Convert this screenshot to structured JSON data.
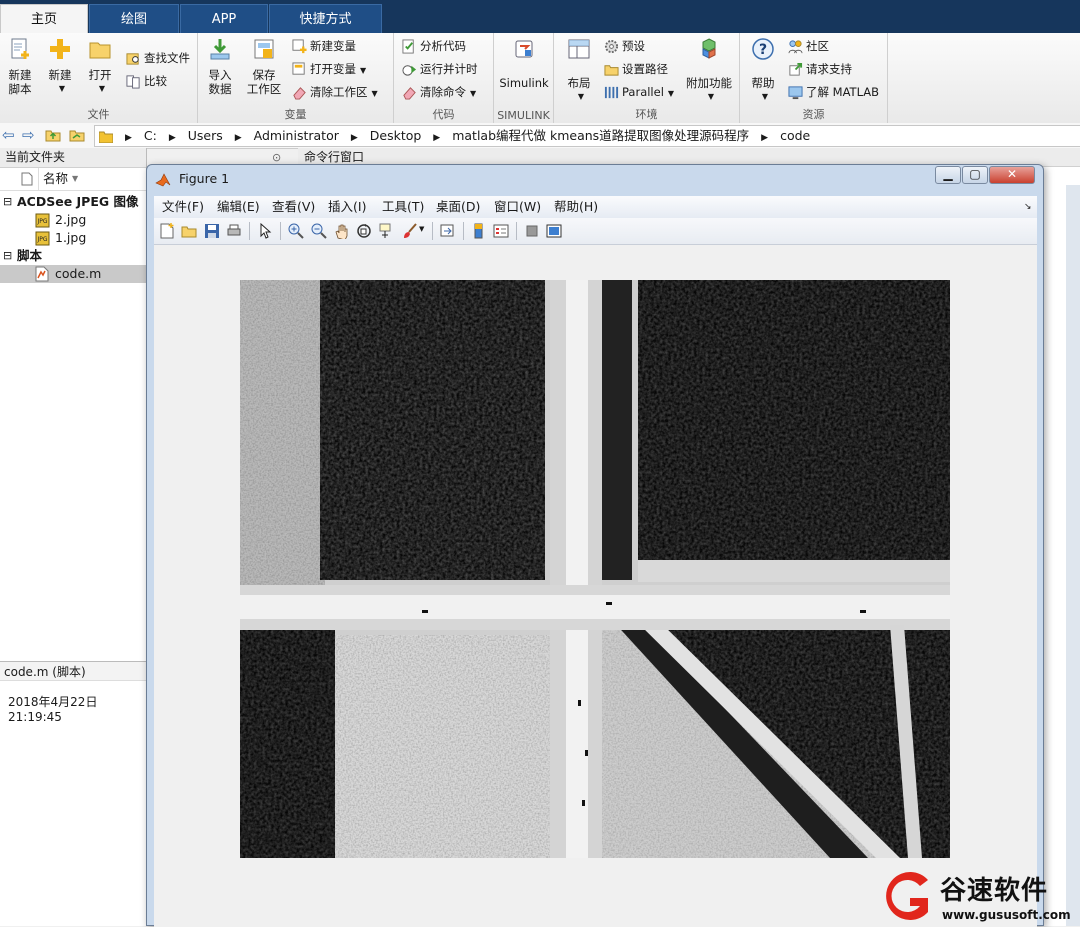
{
  "tabs": [
    {
      "label": "主页"
    },
    {
      "label": "绘图"
    },
    {
      "label": "APP"
    },
    {
      "label": "快捷方式"
    }
  ],
  "ribbon": {
    "file": {
      "title": "文件",
      "new_script": "新建\n脚本",
      "new": "新建",
      "open": "打开",
      "find_files": "查找文件",
      "compare": "比较"
    },
    "variable": {
      "title": "变量",
      "import": "导入\n数据",
      "save_ws": "保存\n工作区",
      "new_var": "新建变量",
      "open_var": "打开变量",
      "clear_ws": "清除工作区"
    },
    "code": {
      "title": "代码",
      "analyze": "分析代码",
      "run_time": "运行并计时",
      "clear_cmd": "清除命令"
    },
    "simulink": {
      "title": "SIMULINK",
      "label": "Simulink"
    },
    "env": {
      "title": "环境",
      "layout": "布局",
      "prefs": "预设",
      "set_path": "设置路径",
      "parallel": "Parallel",
      "addons": "附加功能"
    },
    "resources": {
      "title": "资源",
      "help": "帮助",
      "community": "社区",
      "request_support": "请求支持",
      "learn": "了解 MATLAB"
    }
  },
  "address": {
    "crumbs": [
      "C:",
      "Users",
      "Administrator",
      "Desktop",
      "matlab编程代做 kmeans道路提取图像处理源码程序",
      "code"
    ]
  },
  "current_folder": {
    "title": "当前文件夹",
    "col_name": "名称",
    "groups": [
      {
        "label": "ACDSee JPEG 图像",
        "files": [
          "2.jpg",
          "1.jpg"
        ]
      },
      {
        "label": "脚本",
        "files": [
          "code.m"
        ]
      }
    ],
    "details_title": "code.m  (脚本)",
    "details_date": "2018年4月22日21:19:45"
  },
  "command_window": {
    "title": "命令行窗口"
  },
  "figure": {
    "title": "Figure 1",
    "menus": [
      "文件(F)",
      "编辑(E)",
      "查看(V)",
      "插入(I)",
      "工具(T)",
      "桌面(D)",
      "窗口(W)",
      "帮助(H)"
    ]
  },
  "watermark": {
    "brand": "谷速软件",
    "url": "www.gususoft.com"
  },
  "colors": {
    "tab_bar": "#16365c",
    "accent_icon": "#f2b319",
    "watermark_red": "#e1261c"
  }
}
